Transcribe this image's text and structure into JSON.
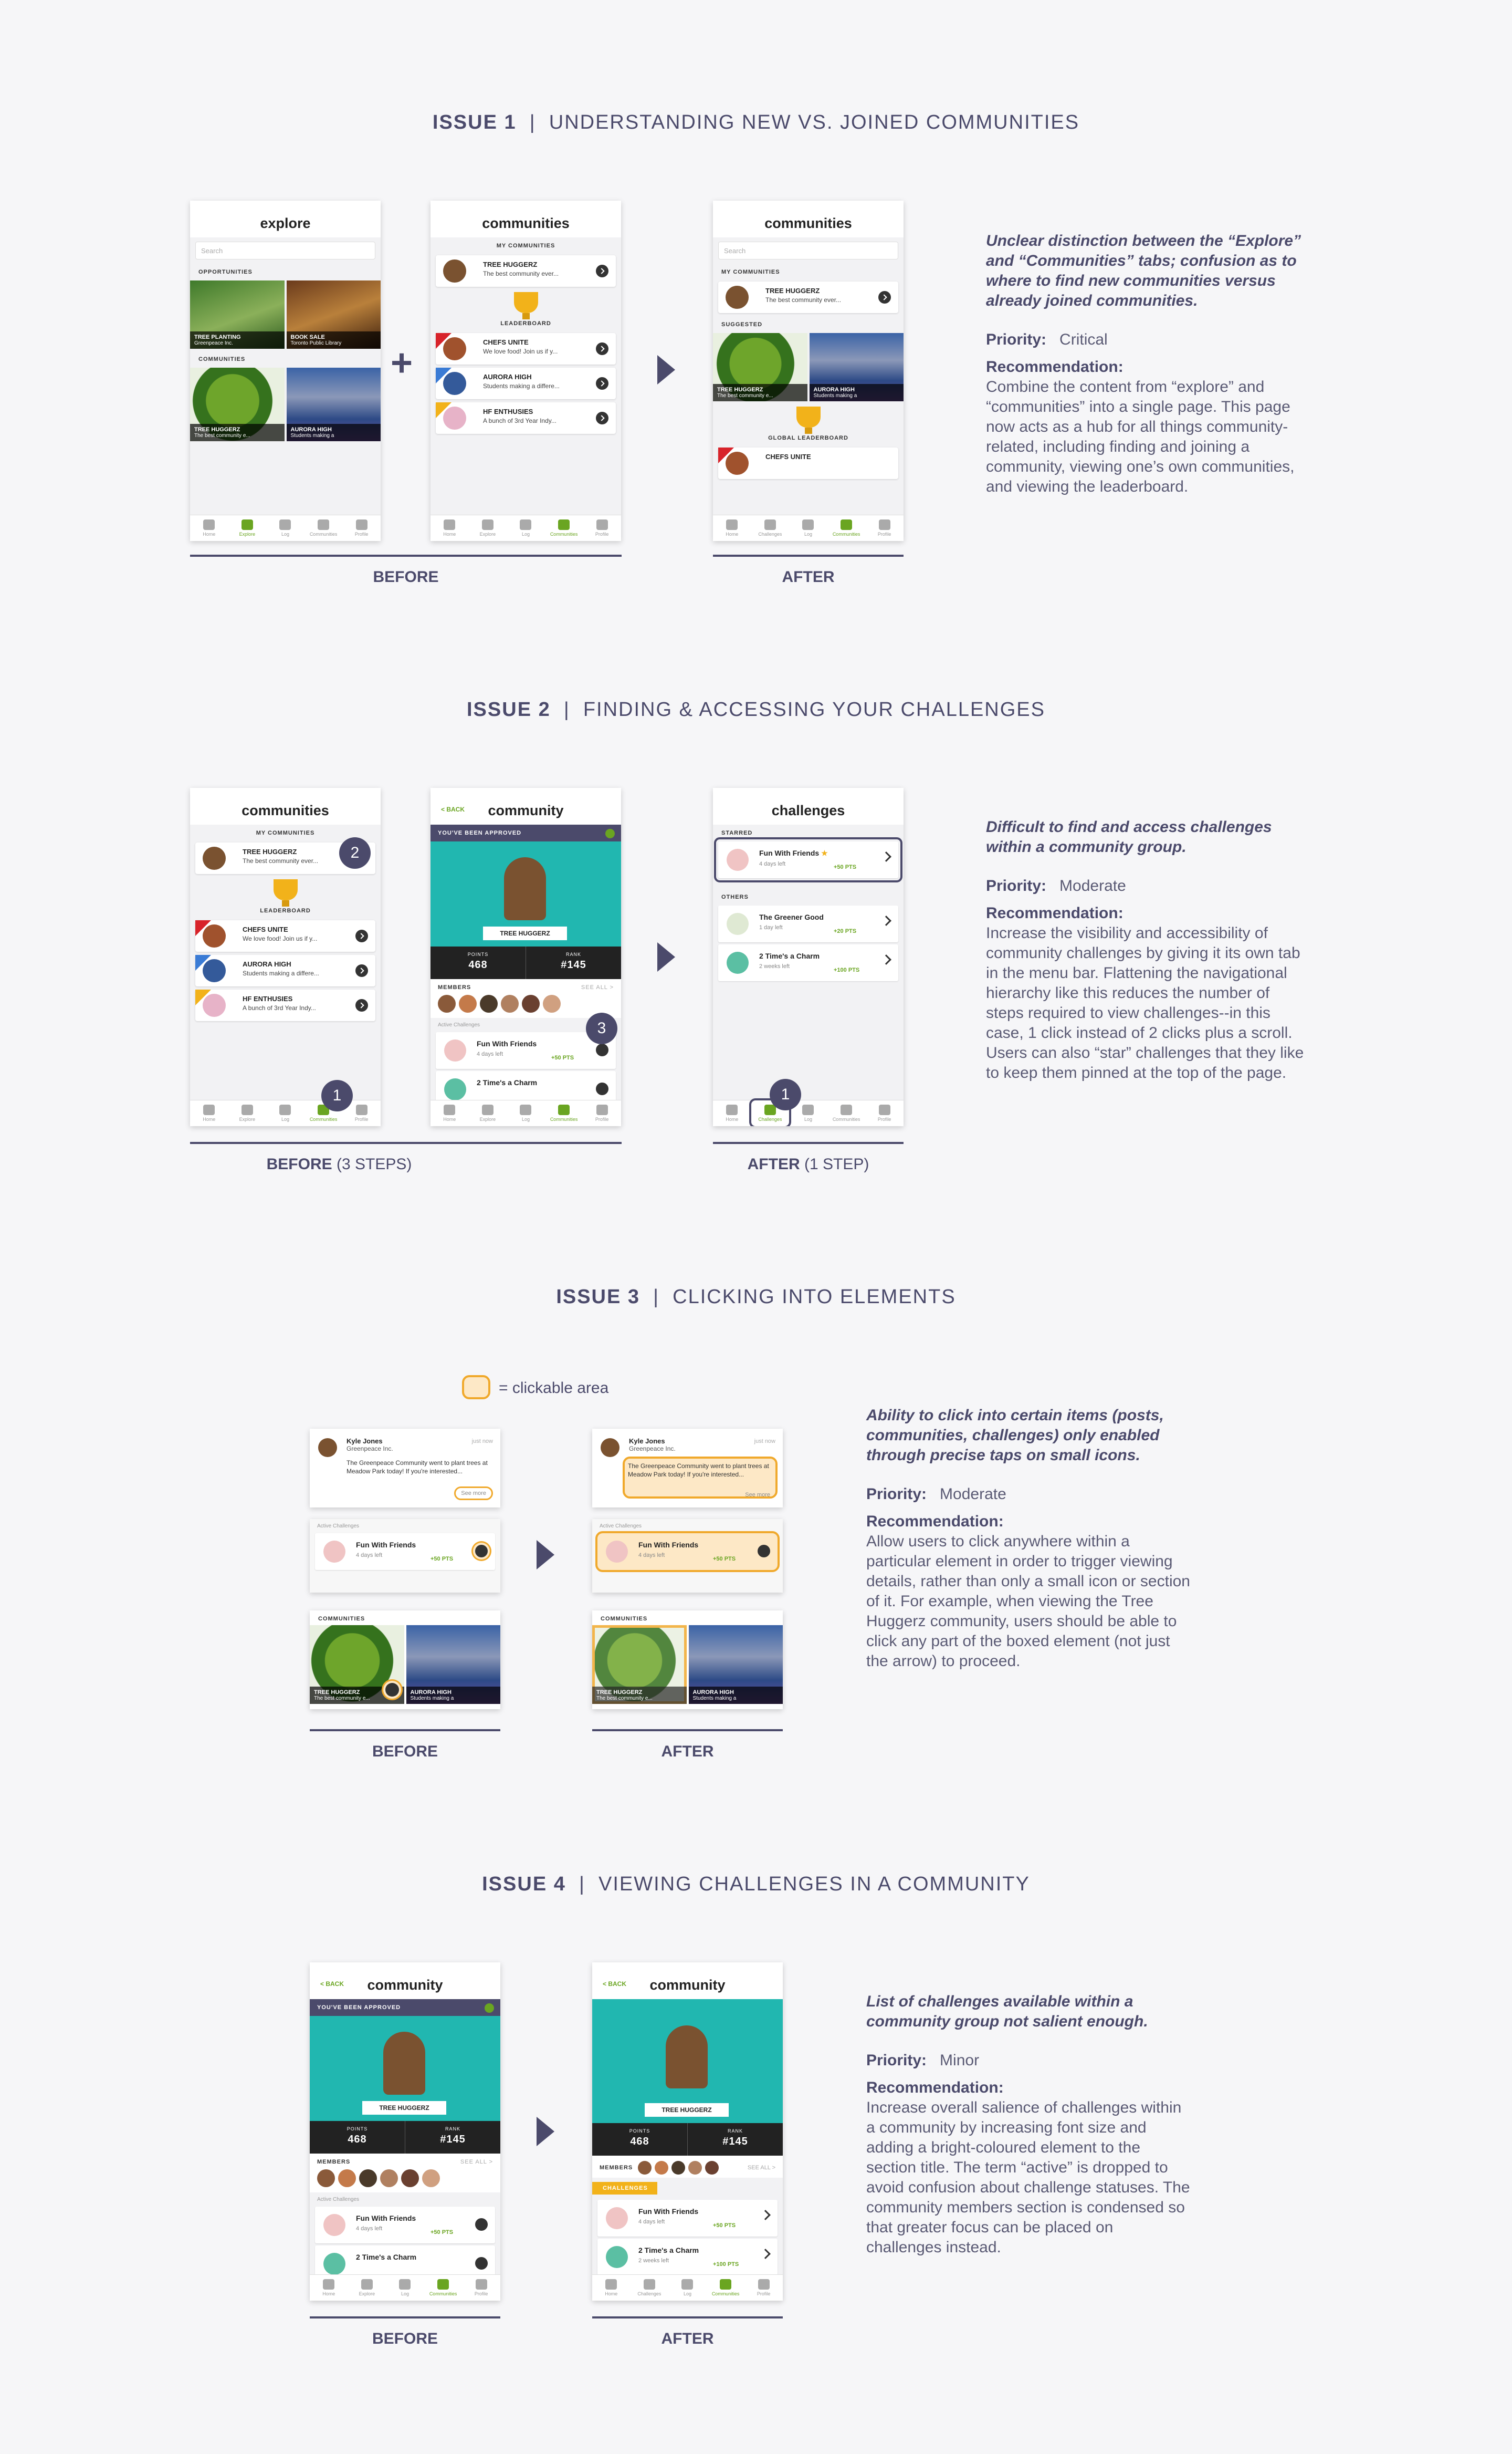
{
  "issues": [
    {
      "num": "ISSUE 1",
      "title": "UNDERSTANDING NEW VS. JOINED COMMUNITIES",
      "desc": "Unclear distinction between the “Explore” and “Communities” tabs; confusion as to where to find new communities versus already joined communities.",
      "priority_label": "Priority:",
      "priority": "Critical",
      "rec_label": "Recommendation:",
      "rec": "Combine the content from “explore” and “communities” into a single page. This page now acts as a hub for all things community-related, including finding and joining a community, viewing one’s own communities, and viewing the leaderboard.",
      "before": "BEFORE",
      "after": "AFTER"
    },
    {
      "num": "ISSUE 2",
      "title": "FINDING & ACCESSING YOUR CHALLENGES",
      "desc": "Difficult to find and access challenges within a community group.",
      "priority_label": "Priority:",
      "priority": "Moderate",
      "rec_label": "Recommendation:",
      "rec": "Increase the visibility and accessibility of community challenges by giving it its own tab in the menu bar. Flattening the navigational hierarchy like this reduces the number of steps required to view challenges--in this case, 1 click instead of 2 clicks plus a scroll. Users can also “star” challenges that they like to keep them pinned at the top of the page.",
      "before": "BEFORE",
      "before_note": "(3 STEPS)",
      "after": "AFTER",
      "after_note": "(1 STEP)"
    },
    {
      "num": "ISSUE 3",
      "title": "CLICKING INTO ELEMENTS",
      "desc": "Ability to click into certain items (posts, communities, challenges) only enabled through precise taps on small icons.",
      "priority_label": "Priority:",
      "priority": "Moderate",
      "rec_label": "Recommendation:",
      "rec": "Allow users to click anywhere within a particular element in order to trigger viewing details, rather than only a small icon or section of it. For example, when viewing the Tree Huggerz community, users should be able to click any part of the boxed element (not just the arrow) to proceed.",
      "before": "BEFORE",
      "after": "AFTER",
      "legend": "= clickable area"
    },
    {
      "num": "ISSUE 4",
      "title": "VIEWING CHALLENGES IN A COMMUNITY",
      "desc": "List of challenges available within a community group not salient enough.",
      "priority_label": "Priority:",
      "priority": "Minor",
      "rec_label": "Recommendation:",
      "rec": "Increase overall salience of challenges within a community by increasing font size and adding a bright-coloured element to the section title. The term “active” is dropped to avoid confusion about challenge statuses. The community members section is condensed so that greater focus can be placed on challenges instead.",
      "before": "BEFORE",
      "after": "AFTER"
    }
  ],
  "screens": {
    "explore_title": "explore",
    "communities_title": "communities",
    "challenges_title": "challenges",
    "community_title": "community",
    "search": "Search",
    "opportunities": "OPPORTUNITIES",
    "communities_sec": "COMMUNITIES",
    "my_communities": "MY COMMUNITIES",
    "leaderboard": "LEADERBOARD",
    "suggested": "SUGGESTED",
    "global_leaderboard": "GLOBAL LEADERBOARD",
    "tree_planting": "TREE PLANTING",
    "tree_planting_sub": "Greenpeace Inc.",
    "book_sale": "BOOK SALE",
    "book_sale_sub": "Toronto Public Library",
    "tree_huggerz": "TREE HUGGERZ",
    "tree_huggerz_sub": "The best community ever...",
    "tree_huggerz_short": "The best community e...",
    "aurora_high": "AURORA HIGH",
    "aurora_high_sub": "Students making a differe...",
    "aurora_short": "Students making a",
    "chefs_unite": "CHEFS UNITE",
    "chefs_unite_sub": "We love food! Join us if y...",
    "hf_enthusies": "HF ENTHUSIES",
    "hf_enthusies_sub": "A bunch of 3rd Year Indy...",
    "tabs_old": [
      "Home",
      "Explore",
      "Log",
      "Communities",
      "Profile"
    ],
    "tabs_new": [
      "Home",
      "Challenges",
      "Log",
      "Communities",
      "Profile"
    ],
    "back": "< BACK",
    "approved": "YOU'VE BEEN APPROVED",
    "points_label": "POINTS",
    "points": "468",
    "rank_label": "RANK",
    "rank": "#145",
    "members": "MEMBERS",
    "see_all": "SEE ALL >",
    "active_challenges": "Active Challenges",
    "challenges_tag": "CHALLENGES",
    "starred": "STARRED",
    "others": "OTHERS",
    "fun_with_friends": "Fun With Friends",
    "four_days": "4 days left",
    "pts50": "+50 PTS",
    "greener_good": "The Greener Good",
    "one_day": "1 day left",
    "pts20": "+20 PTS",
    "times_charm": "2 Time's a Charm",
    "two_weeks": "2 weeks left",
    "pts100": "+100 PTS",
    "kyle": "Kyle Jones",
    "greenpeace": "Greenpeace Inc.",
    "just_now": "just now",
    "post_text": "The Greenpeace Community went to plant trees at Meadow Park today! If you're interested...",
    "see_more": "See more"
  },
  "steps": {
    "one": "1",
    "two": "2",
    "three": "3"
  },
  "colors": {
    "accent": "#4b4a6b",
    "green": "#6aa521",
    "orange": "#f0a92c",
    "teal": "#21b7b0"
  }
}
